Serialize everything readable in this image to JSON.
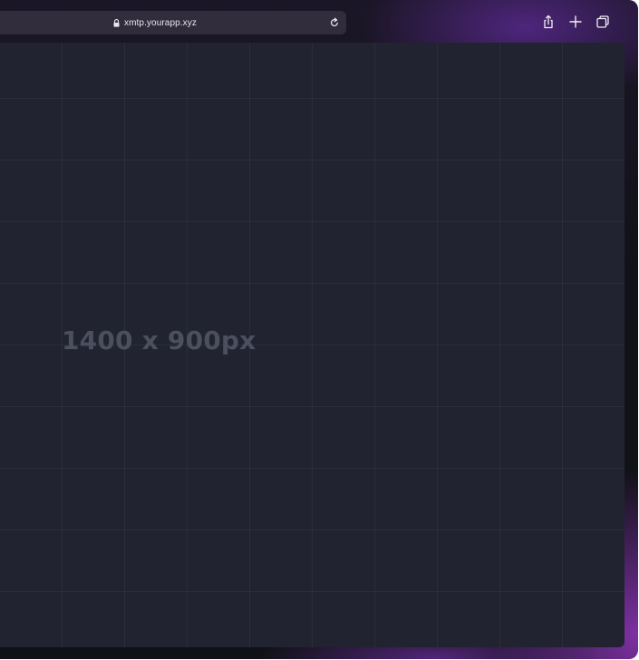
{
  "address_bar": {
    "url": "xmtp.yourapp.xyz",
    "lock_icon": "lock-icon",
    "reload_icon": "reload-icon"
  },
  "toolbar": {
    "icons": [
      "share-icon",
      "new-tab-icon",
      "tabs-overview-icon"
    ]
  },
  "viewport": {
    "placeholder_label": "1400 x 900px"
  },
  "colors": {
    "frame_dark": "#111219",
    "frame_glow": "#8232aa",
    "viewport_bg": "#212430",
    "placeholder_text": "#4b4f5e"
  }
}
